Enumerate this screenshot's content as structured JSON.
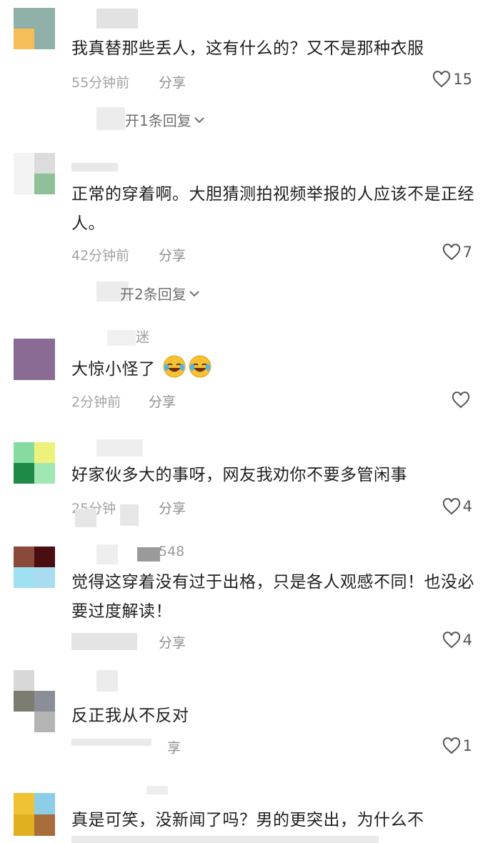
{
  "comments": [
    {
      "username": "",
      "text": "我真替那些丢人，这有什么的？又不是那种衣服",
      "time": "55分钟前",
      "share": "分享",
      "likes": "15",
      "replies": "开1条回复"
    },
    {
      "username": "",
      "text": "正常的穿着啊。大胆猜测拍视频举报的人应该不是正经人。",
      "time": "42分钟前",
      "share": "分享",
      "likes": "7",
      "replies": "开2条回复"
    },
    {
      "username": "迷",
      "text": "大惊小怪了",
      "emoji_icons": [
        "rofl-emoji-icon",
        "rofl-emoji-icon"
      ],
      "time": "2分钟前",
      "share": "分享",
      "likes": ""
    },
    {
      "username": "",
      "text": "好家伙多大的事呀，网友我劝你不要多管闲事",
      "time": "25分钟",
      "share": "分享",
      "likes": "4"
    },
    {
      "username": "548",
      "text": "觉得这穿着没有过于出格，只是各人观感不同！也没必要过度解读！",
      "time": "",
      "share": "分享",
      "likes": "4"
    },
    {
      "username": "",
      "text": "反正我从不反对",
      "time": "",
      "share": "享",
      "likes": "1"
    },
    {
      "username": "",
      "text": "真是可笑，没新闻了吗？男的更突出，为什么不",
      "time": "",
      "share": "",
      "likes": ""
    }
  ],
  "icons": {
    "like": "heart-outline-icon",
    "expand": "chevron-down-icon"
  },
  "colors": {
    "text": "#1f1f1f",
    "meta": "#a3a3a3",
    "background": "#ffffff"
  }
}
